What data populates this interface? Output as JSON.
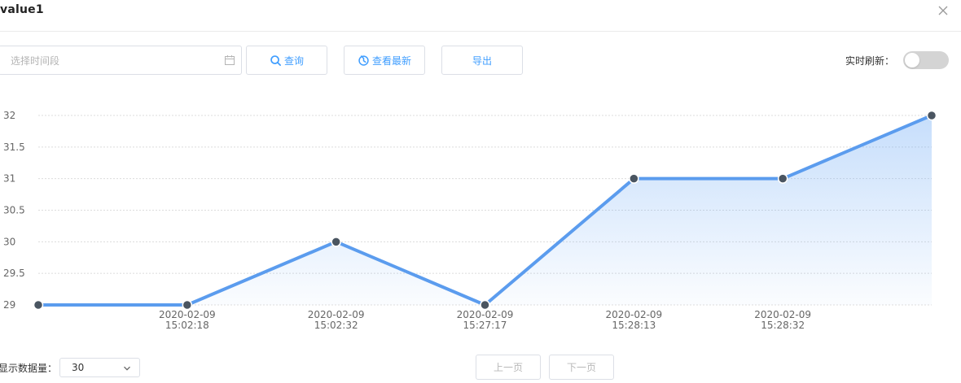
{
  "header": {
    "title": "value1"
  },
  "toolbar": {
    "date_placeholder": "选择时间段",
    "query_label": "查询",
    "latest_label": "查看最新",
    "export_label": "导出",
    "realtime_label": "实时刷新：",
    "realtime_on": false
  },
  "icons": {
    "close": "close-icon",
    "calendar": "calendar-icon",
    "search": "search-icon",
    "refresh": "refresh-icon",
    "chevron": "chevron-down-icon"
  },
  "colors": {
    "accent": "#409eff",
    "line": "#5b9cee",
    "point": "#4a5561"
  },
  "chart_data": {
    "type": "area",
    "x": [
      "",
      "2020-02-09 15:02:18",
      "2020-02-09 15:02:32",
      "2020-02-09 15:27:17",
      "2020-02-09 15:28:13",
      "2020-02-09 15:28:32",
      ""
    ],
    "series": [
      {
        "values": [
          29,
          29,
          30,
          29,
          31,
          31,
          32
        ]
      }
    ],
    "yticks": [
      "29",
      "29.5",
      "30",
      "30.5",
      "31",
      "31.5",
      "32"
    ],
    "ylim": [
      29,
      32
    ],
    "grid": true,
    "legend": "none"
  },
  "footer": {
    "count_label": "显示数据量：",
    "count_value": "30",
    "prev_label": "上一页",
    "next_label": "下一页"
  }
}
